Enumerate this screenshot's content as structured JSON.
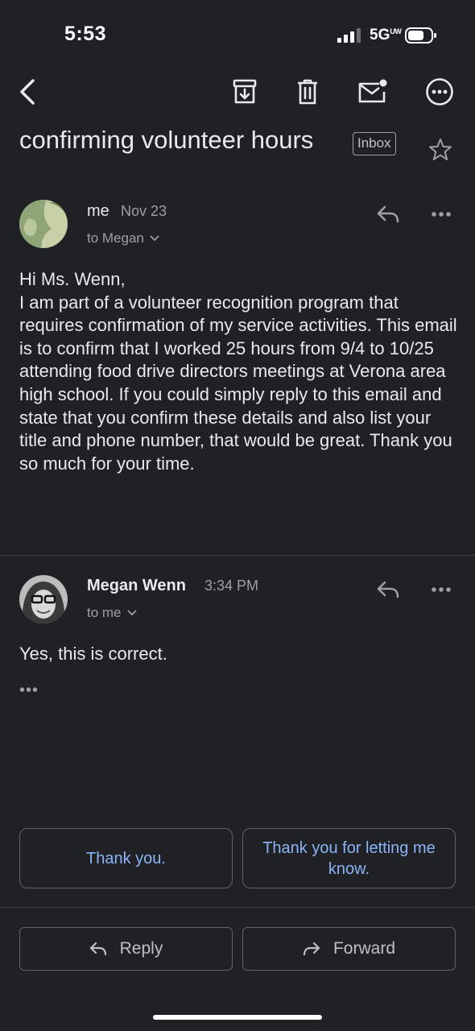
{
  "status_bar": {
    "time": "5:53",
    "network": "5G",
    "network_sub": "UW"
  },
  "toolbar": {
    "back_icon": "chevron-left-icon",
    "archive_icon": "archive-icon",
    "delete_icon": "trash-icon",
    "mark_unread_icon": "mark-unread-icon",
    "more_icon": "more-horizontal-icon"
  },
  "thread": {
    "subject": "confirming volunteer hours",
    "label": "Inbox"
  },
  "messages": [
    {
      "sender": "me",
      "date": "Nov 23",
      "recipient": "to Megan",
      "body": "Hi Ms. Wenn,\nI am part of a volunteer recognition program that requires confirmation of my service activities. This email is to confirm that I worked 25 hours from 9/4 to 10/25 attending food drive directors meetings at Verona area high school. If you could simply reply to this email and state that you confirm these details and also list your title and phone number, that would be great. Thank you so much for your time."
    },
    {
      "sender": "Megan Wenn",
      "date": "3:34 PM",
      "recipient": "to me",
      "body": "Yes, this is correct.",
      "trimmed": "•••"
    }
  ],
  "smart_replies": [
    "Thank you.",
    "Thank you for letting me know."
  ],
  "actions": {
    "reply": "Reply",
    "forward": "Forward"
  },
  "colors": {
    "background": "#202124",
    "text": "#e8eaed",
    "secondary": "#9aa0a6",
    "accent": "#8ab4f8"
  }
}
